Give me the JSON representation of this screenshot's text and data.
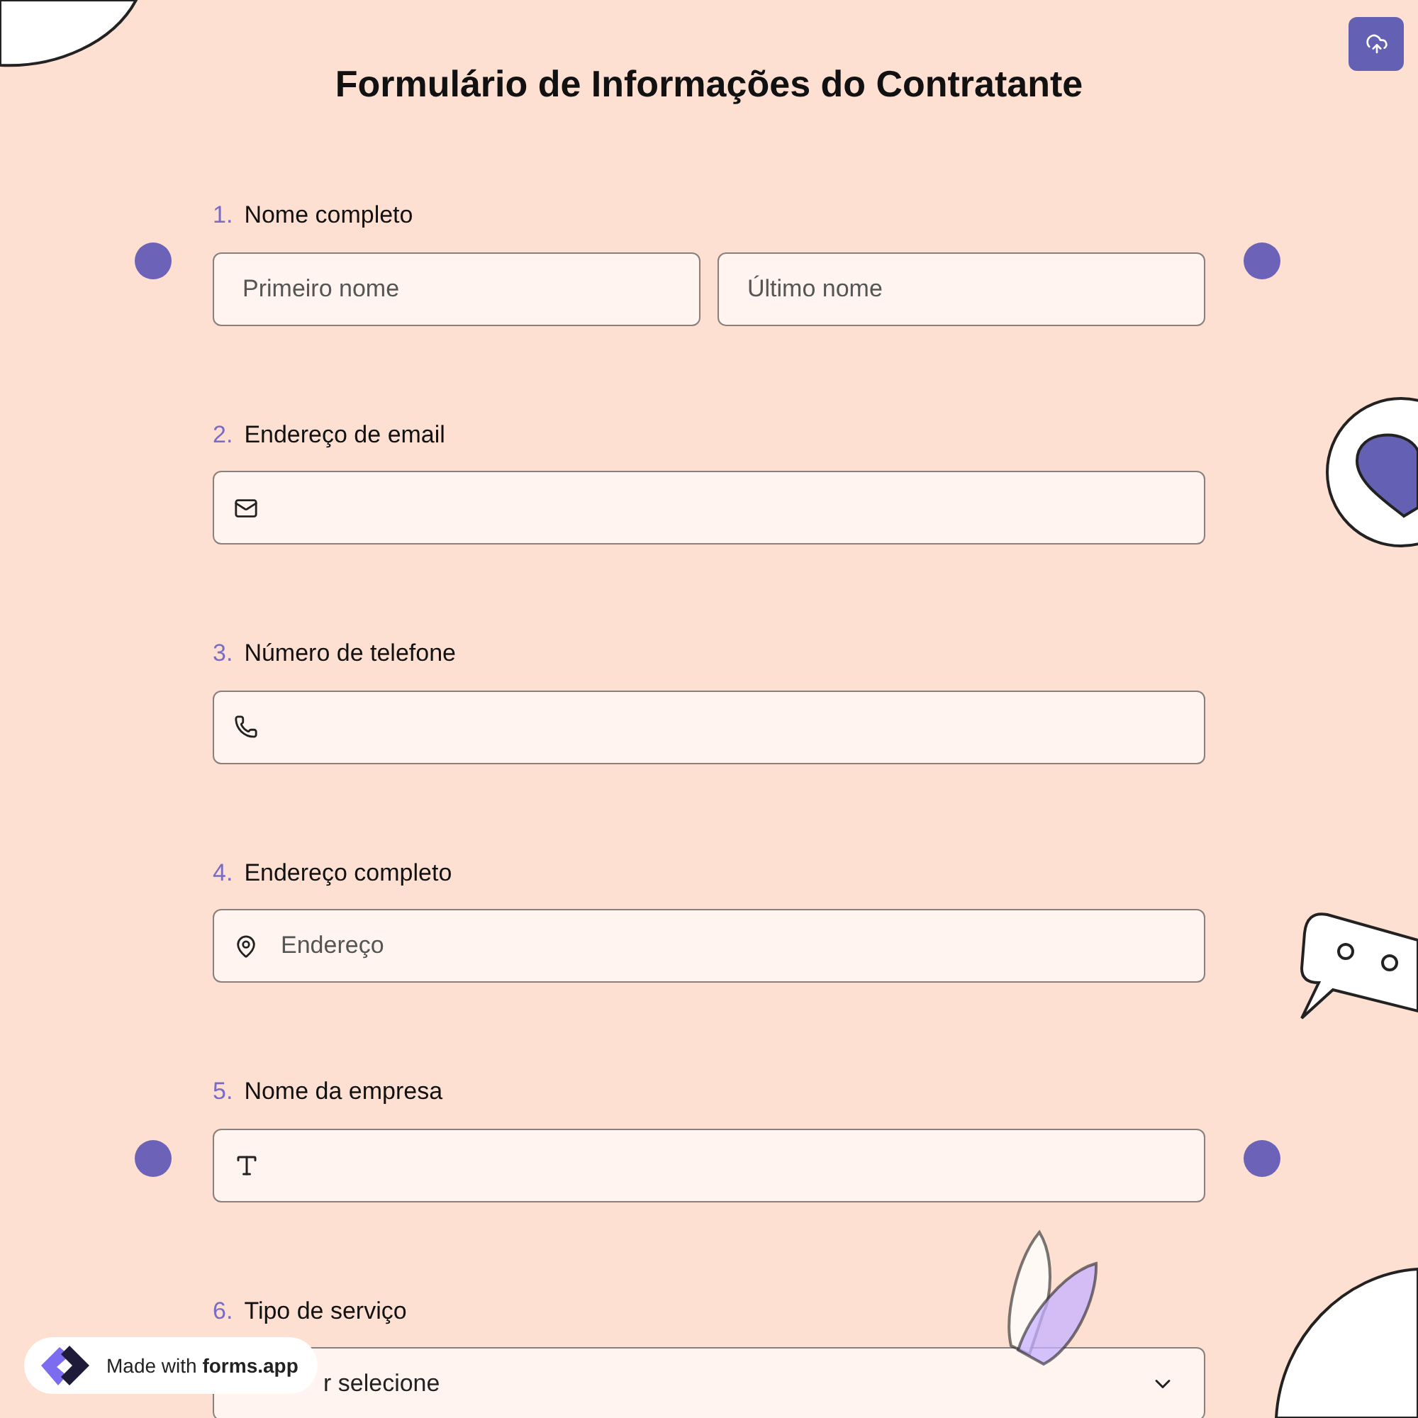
{
  "title": "Formulário de Informações do Contratante",
  "questions": [
    {
      "number": "1.",
      "label": "Nome completo",
      "kind": "name",
      "fields": [
        {
          "placeholder": "Primeiro nome"
        },
        {
          "placeholder": "Último nome"
        }
      ]
    },
    {
      "number": "2.",
      "label": "Endereço de email",
      "kind": "email"
    },
    {
      "number": "3.",
      "label": "Número de telefone",
      "kind": "phone"
    },
    {
      "number": "4.",
      "label": "Endereço completo",
      "kind": "address",
      "placeholder": "Endereço"
    },
    {
      "number": "5.",
      "label": "Nome da empresa",
      "kind": "text"
    },
    {
      "number": "6.",
      "label": "Tipo de serviço",
      "kind": "select",
      "visible_text": "r selecione"
    }
  ],
  "badge": {
    "prefix": "Made with",
    "brand": "forms.app"
  }
}
